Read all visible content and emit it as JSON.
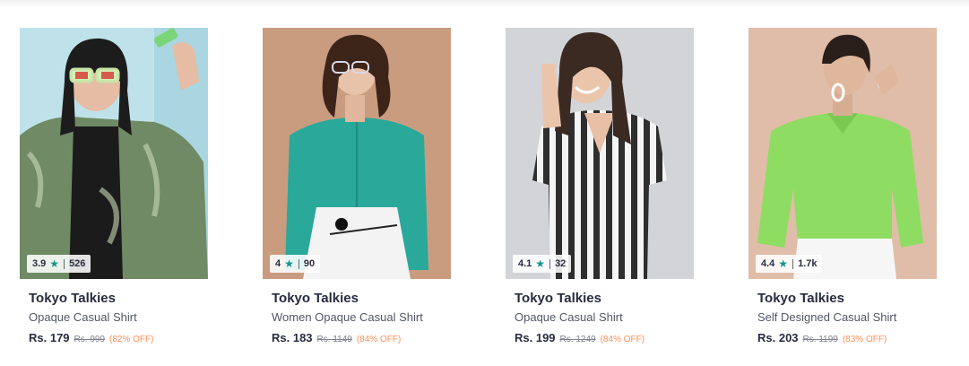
{
  "products": [
    {
      "brand": "Tokyo Talkies",
      "name": "Opaque Casual Shirt",
      "price": "Rs. 179",
      "mrp": "Rs. 999",
      "discount": "(82% OFF)",
      "rating": "3.9",
      "rating_count": "526",
      "bg_color": "#bfe2ea",
      "shirt_color": "#6f8a64"
    },
    {
      "brand": "Tokyo Talkies",
      "name": "Women Opaque Casual Shirt",
      "price": "Rs. 183",
      "mrp": "Rs. 1149",
      "discount": "(84% OFF)",
      "rating": "4",
      "rating_count": "90",
      "bg_color": "#c99c80",
      "shirt_color": "#2aa89a"
    },
    {
      "brand": "Tokyo Talkies",
      "name": "Opaque Casual Shirt",
      "price": "Rs. 199",
      "mrp": "Rs. 1249",
      "discount": "(84% OFF)",
      "rating": "4.1",
      "rating_count": "32",
      "bg_color": "#d3d4d8",
      "shirt_color": "#2e2e2e"
    },
    {
      "brand": "Tokyo Talkies",
      "name": "Self Designed Casual Shirt",
      "price": "Rs. 203",
      "mrp": "Rs. 1199",
      "discount": "(83% OFF)",
      "rating": "4.4",
      "rating_count": "1.7k",
      "bg_color": "#e0bda8",
      "shirt_color": "#8fdc63"
    }
  ],
  "icons": {
    "rating": "star-icon"
  },
  "colors": {
    "star": "#14958f",
    "discount": "#ff905a",
    "brand_text": "#282c3f"
  }
}
